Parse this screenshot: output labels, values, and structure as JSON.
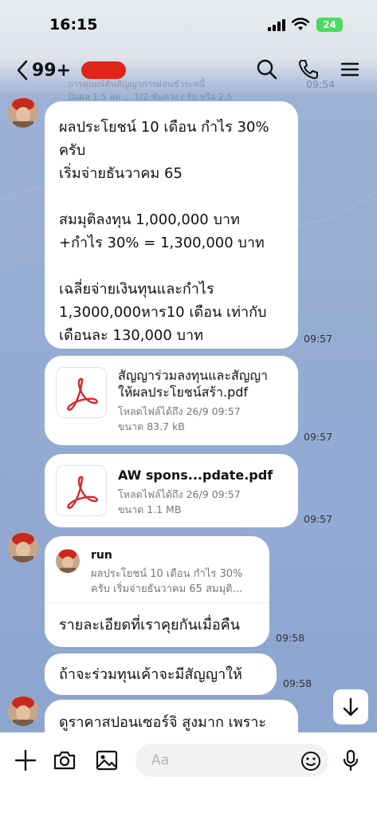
{
  "status": {
    "time": "16:15",
    "battery": "24"
  },
  "header": {
    "unread_count": "99+"
  },
  "background_text": {
    "line1": "การคุณณ์ต้นสัญญาการผ่อนชำระหนี้",
    "line2": "ปันผล 1.5 ลด ... 1/2 ชันทาง / รับ หรือ 2.5",
    "top_time": "09:54"
  },
  "messages": [
    {
      "text": "ผลประโยชน์ 10 เดือน  กำไร 30%\nครับ\nเริ่มจ่ายธันวาคม 65\n\nสมมุติลงทุน 1,000,000 บาท\n+กำไร 30% = 1,300,000 บาท\n\nเฉลี่ยจ่ายเงินทุนและกำไร\n1,3000,000หาร10 เดือน เท่ากับ\nเดือนละ 130,000 บาท",
      "time": "09:57"
    },
    {
      "file_name": "สัญญาร่วมลงทุนและสัญญา\nให้ผลประโยชน์สร้า.pdf",
      "expiry": "โหลดไฟล์ได้ถึง 26/9 09:57",
      "size": "ขนาด 83.7 kB",
      "time": "09:57"
    },
    {
      "file_name": "AW spons...pdate.pdf",
      "expiry": "โหลดไฟล์ได้ถึง 26/9 09:57",
      "size": "ขนาด 1.1 MB",
      "time": "09:57"
    },
    {
      "reply_sender": "run",
      "reply_preview": "ผลประโยชน์ 10 เดือน กำไร 30%\nครับ เริ่มจ่ายธันวาคม 65 สมมุติ...",
      "text": "รายละเอียดที่เราคุยกันเมื่อคืน",
      "time": "09:58"
    },
    {
      "text": "ถ้าจะร่วมทุนเค้าจะมีสัญญาให้",
      "time": "09:58"
    },
    {
      "text": "ดูราคาสปอนเซอร์จิ  สูงมาก เพราะ"
    }
  ],
  "input": {
    "placeholder": "Aa"
  },
  "icons": {
    "back": "chevron-left-icon",
    "search": "search-icon",
    "call": "phone-icon",
    "menu": "menu-icon",
    "add": "plus-icon",
    "camera": "camera-icon",
    "gallery": "image-icon",
    "emoji": "emoji-icon",
    "mic": "microphone-icon",
    "pdf": "pdf-icon",
    "scroll": "arrow-down-icon"
  },
  "colors": {
    "background": "#8ea6cf",
    "bubble": "#ffffff",
    "redaction": "#e0251b",
    "pdf_red": "#d8262b",
    "battery": "#4cd964"
  }
}
